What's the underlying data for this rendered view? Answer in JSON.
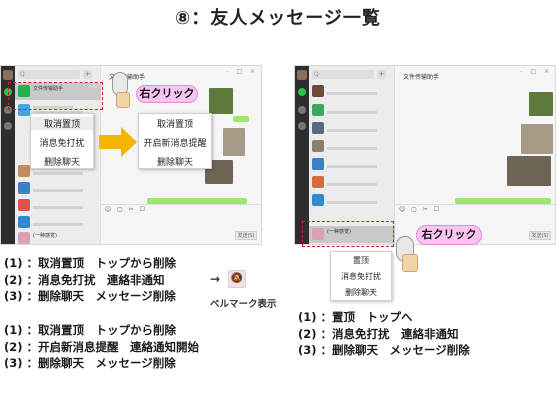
{
  "title": "⑧：友人メッセージ一覧",
  "left_screen": {
    "window_title": "文件传输助手",
    "search_placeholder": "Q",
    "chats": [
      {
        "name": "文件传输助手"
      },
      {
        "name": "微信团队"
      },
      {
        "name": ""
      },
      {
        "name": ""
      },
      {
        "name": "微信支付"
      },
      {
        "name": "腾讯新闻"
      },
      {
        "name": "微信公众平台"
      },
      {
        "name": "(一种感觉)"
      }
    ],
    "send_label": "发送(S)",
    "context_menu": [
      "取消置顶",
      "消息免打扰",
      "删除聊天"
    ],
    "context_menu_after": [
      "取消置顶",
      "开启新消息提醒",
      "删除聊天"
    ],
    "callout": "右クリック"
  },
  "right_screen": {
    "window_title": "文件传输助手",
    "search_placeholder": "Q",
    "chats": [
      {
        "name": ""
      },
      {
        "name": ""
      },
      {
        "name": ""
      },
      {
        "name": ""
      },
      {
        "name": ""
      },
      {
        "name": ""
      },
      {
        "name": ""
      },
      {
        "name": "(一种感觉)"
      }
    ],
    "send_label": "发送(S)",
    "context_menu": [
      "置顶",
      "消息免打扰",
      "删除聊天"
    ],
    "callout": "右クリック"
  },
  "left_list_a": [
    "(1) ：取消置顶　トップから削除",
    "(2) ：消息免打扰　連絡非通知",
    "(3) ：删除聊天　メッセージ削除"
  ],
  "arrow_label": "→",
  "bell_note": "ベルマーク表示",
  "left_list_b": [
    "(1) ：取消置顶　トップから削除",
    "(2) ：开启新消息提醒　連絡通知開始",
    "(3) ：删除聊天　メッセージ削除"
  ],
  "right_list": [
    "(1) ：置顶　トップへ",
    "(2) ：消息免打扰　連絡非通知",
    "(3) ：删除聊天　メッセージ削除"
  ],
  "colors": {
    "callout_fill": "#f9c4f2",
    "dash": "#d01919",
    "arrow": "#f5b400",
    "selected_row": "#c9c9c9"
  }
}
